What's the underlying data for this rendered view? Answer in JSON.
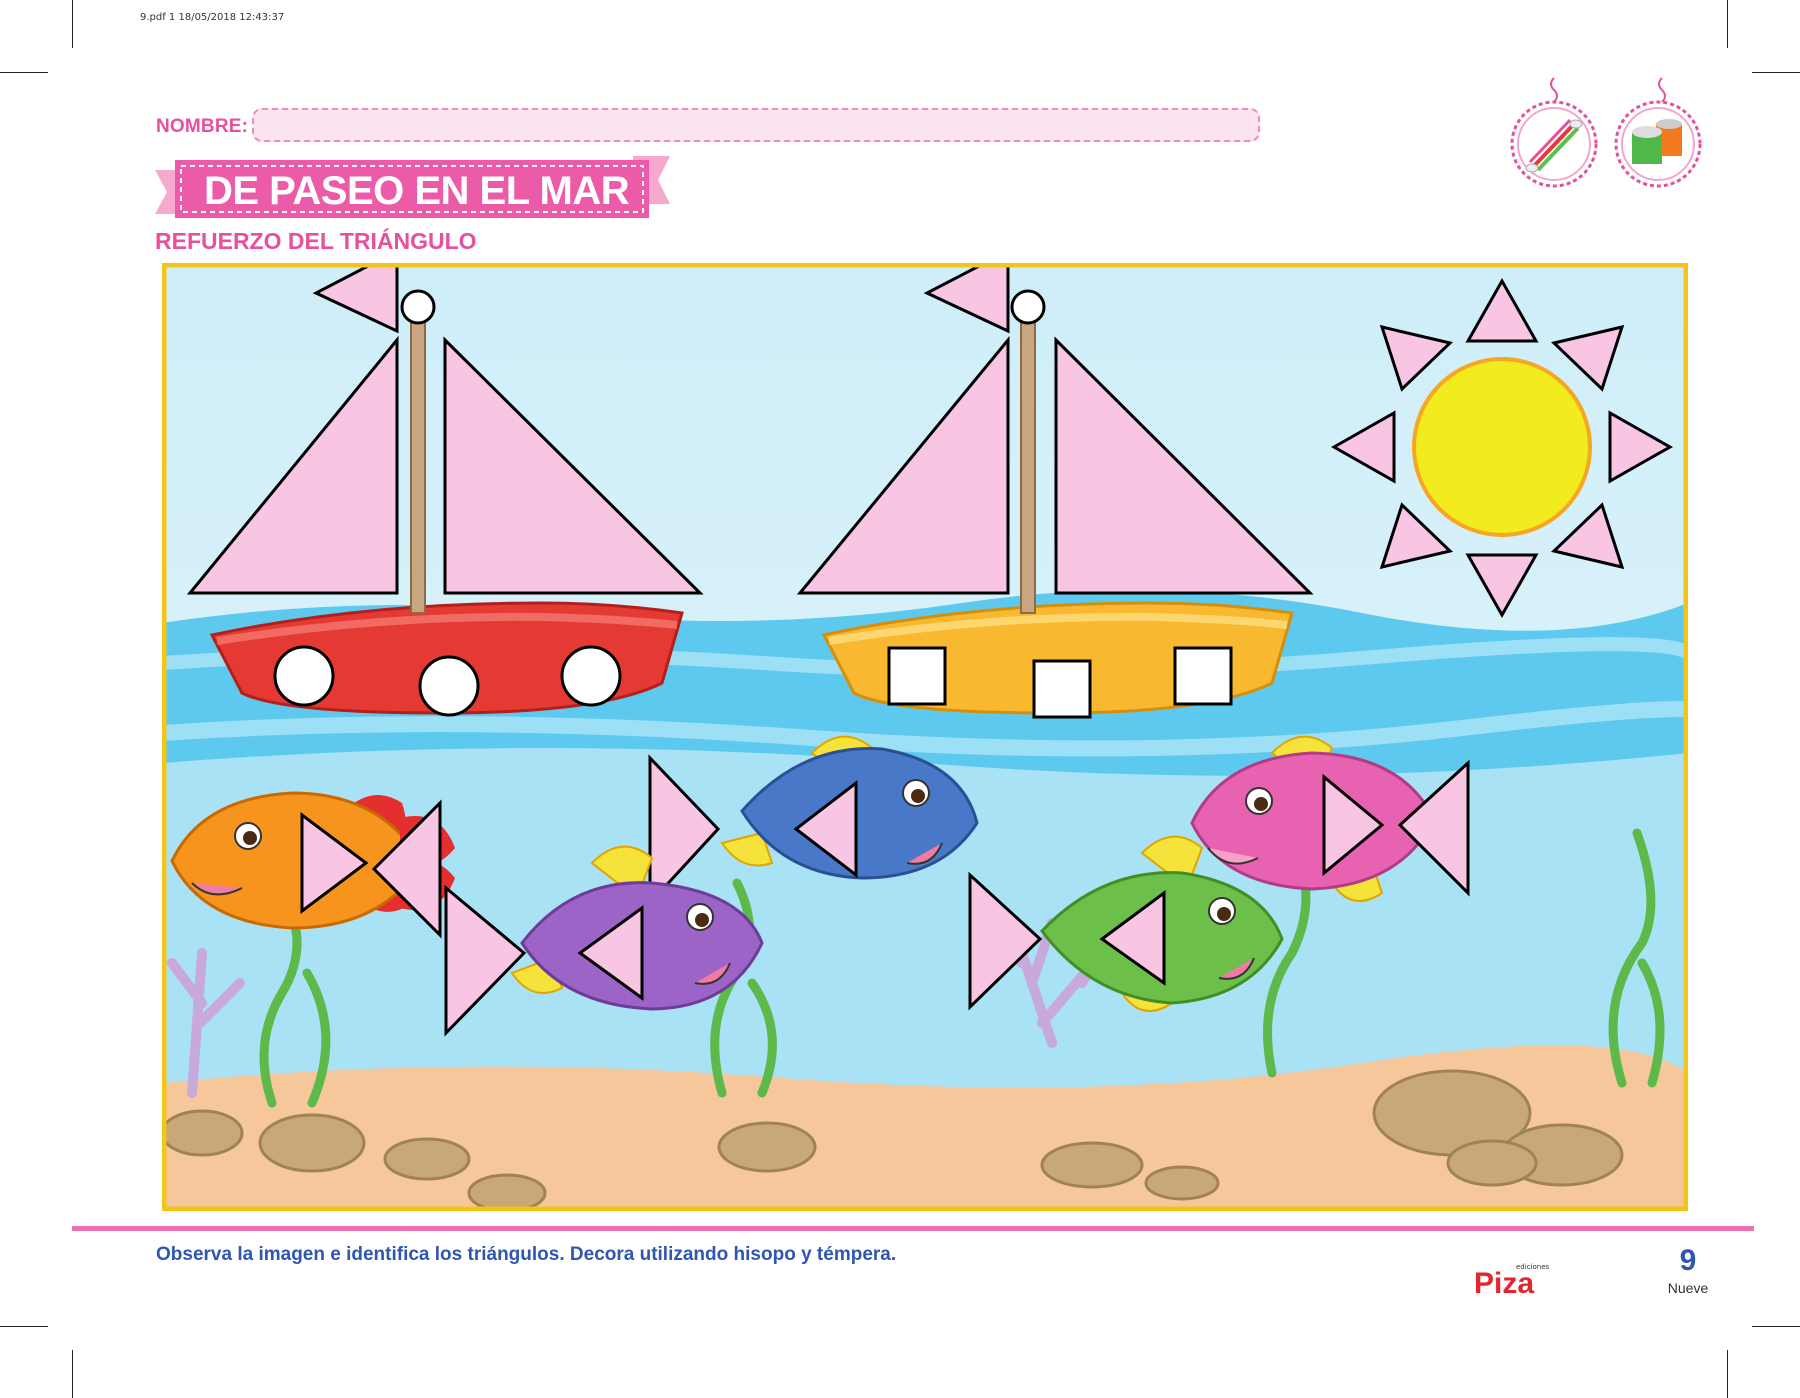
{
  "print_info": "9.pdf   1   18/05/2018   12:43:37",
  "header": {
    "name_label": "NOMBRE:",
    "name_value": "",
    "title": "DE PASEO EN EL MAR",
    "subtitle": "REFUERZO DEL TRIÁNGULO"
  },
  "tools": [
    {
      "icon": "cotton-swab-icon"
    },
    {
      "icon": "paint-pots-icon"
    }
  ],
  "scene": {
    "boats": [
      {
        "color": "#e53a33",
        "windows": "circles",
        "window_count": 3
      },
      {
        "color": "#f8b830",
        "windows": "squares",
        "window_count": 3
      }
    ],
    "sun": {
      "color": "#f2ec1e",
      "ray_count": 8
    },
    "fish": [
      {
        "color": "#f7941d"
      },
      {
        "color": "#4a78c8"
      },
      {
        "color": "#e763b2"
      },
      {
        "color": "#9b64c6"
      },
      {
        "color": "#6cc04a"
      }
    ],
    "triangle_fill": "#f8c6e3"
  },
  "footer": {
    "instruction": "Observa la imagen e identifica los triángulos. Decora utilizando hisopo y témpera.",
    "publisher_small": "ediciones",
    "publisher": "Piza",
    "page_number": "9",
    "page_word": "Nueve"
  },
  "colors": {
    "accent_pink": "#e6509d",
    "frame_yellow": "#f2c519",
    "footer_blue": "#2f56b0"
  }
}
